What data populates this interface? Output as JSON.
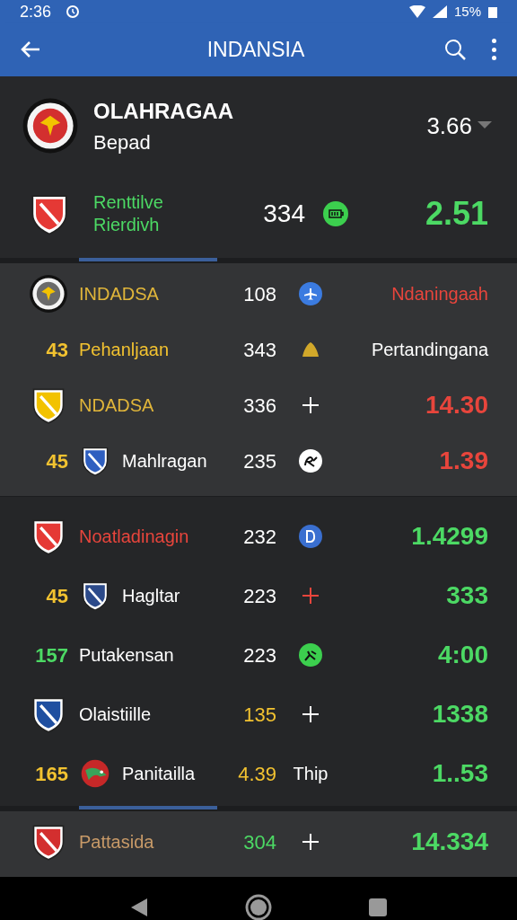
{
  "status_bar": {
    "time": "2:36",
    "battery": "15%"
  },
  "app_bar": {
    "title": "INDANSIA"
  },
  "header": {
    "title": "OLAHRAGAA",
    "subtitle": "Bepad",
    "value": "3.66",
    "crest": {
      "kind": "seal",
      "color": "#d32f2f"
    },
    "featured": {
      "crest": {
        "kind": "shield",
        "color": "#e53935"
      },
      "name_lines": [
        "Renttilve",
        "Rierdivh"
      ],
      "number": "334",
      "marker": {
        "kind": "battery",
        "color": "#3ccf4e"
      },
      "value": "2.51"
    }
  },
  "sections": [
    {
      "rows": [
        {
          "crest": {
            "kind": "seal",
            "color": "#6a6a6a"
          },
          "name": {
            "text": "INDADSA",
            "color": "#e0b53a"
          },
          "number": {
            "text": "108",
            "color": "#ffffff"
          },
          "marker": {
            "kind": "plane",
            "color": "#3b7be0"
          },
          "value": {
            "text": "Ndaningaah",
            "color": "#e8453c",
            "kind": "word"
          }
        },
        {
          "rank": {
            "text": "43",
            "color": "#f2c230"
          },
          "name": {
            "text": "Pehanljaan",
            "color": "#f2c230"
          },
          "number": {
            "text": "343",
            "color": "#ffffff"
          },
          "marker": {
            "kind": "cone",
            "color": "#d2a82a"
          },
          "value": {
            "text": "Pertandingana",
            "color": "#ffffff",
            "kind": "word"
          }
        },
        {
          "crest": {
            "kind": "shield",
            "color": "#f2c200"
          },
          "name": {
            "text": "NDADSA",
            "color": "#e0b53a"
          },
          "number": {
            "text": "336",
            "color": "#ffffff"
          },
          "marker": {
            "kind": "plus",
            "color": "#ffffff"
          },
          "value": {
            "text": "14.30",
            "color": "#e8453c",
            "kind": "number"
          }
        },
        {
          "rank": {
            "text": "45",
            "color": "#f2c230"
          },
          "crest": {
            "kind": "shield",
            "color": "#2f5fc0"
          },
          "name": {
            "text": "Mahlragan",
            "color": "#ffffff"
          },
          "number": {
            "text": "235",
            "color": "#ffffff"
          },
          "marker": {
            "kind": "scribble",
            "color": "#ffffff"
          },
          "value": {
            "text": "1.39",
            "color": "#e8453c",
            "kind": "number"
          }
        }
      ]
    },
    {
      "rows": [
        {
          "crest": {
            "kind": "shield",
            "color": "#e53935"
          },
          "name": {
            "text": "Noatladinagin",
            "color": "#e8453c"
          },
          "number": {
            "text": "232",
            "color": "#ffffff"
          },
          "marker": {
            "kind": "disc",
            "color": "#3a6fd0"
          },
          "value": {
            "text": "1.4299",
            "color": "#4cd964",
            "kind": "number"
          }
        },
        {
          "rank": {
            "text": "45",
            "color": "#f2c230"
          },
          "crest": {
            "kind": "shield",
            "color": "#2c4a8a"
          },
          "name": {
            "text": "Hagltar",
            "color": "#ffffff"
          },
          "number": {
            "text": "223",
            "color": "#ffffff"
          },
          "marker": {
            "kind": "plus",
            "color": "#e8453c"
          },
          "value": {
            "text": "333",
            "color": "#4cd964",
            "kind": "number"
          }
        },
        {
          "rank": {
            "text": "157",
            "color": "#4cd964"
          },
          "name": {
            "text": "Putakensan",
            "color": "#ffffff"
          },
          "number": {
            "text": "223",
            "color": "#ffffff"
          },
          "marker": {
            "kind": "runner",
            "color": "#3ccf4e"
          },
          "value": {
            "text": "4:00",
            "color": "#4cd964",
            "kind": "number"
          }
        },
        {
          "crest": {
            "kind": "shield",
            "color": "#1f4fa0"
          },
          "name": {
            "text": "Olaistiille",
            "color": "#ffffff"
          },
          "number": {
            "text": "135",
            "color": "#f2c230"
          },
          "marker": {
            "kind": "plus",
            "color": "#ffffff"
          },
          "value": {
            "text": "1338",
            "color": "#4cd964",
            "kind": "number"
          }
        },
        {
          "rank": {
            "text": "165",
            "color": "#f2c230"
          },
          "crest": {
            "kind": "dragon",
            "color": "#c62828"
          },
          "name": {
            "text": "Panitailla",
            "color": "#ffffff"
          },
          "number": {
            "text": "4.39",
            "color": "#f2c230"
          },
          "marker": {
            "kind": "text",
            "text": "Thip",
            "color": "#ffffff"
          },
          "value": {
            "text": "1..53",
            "color": "#4cd964",
            "kind": "number"
          }
        }
      ]
    },
    {
      "rows": [
        {
          "crest": {
            "kind": "shield",
            "color": "#d32f2f"
          },
          "name": {
            "text": "Pattasida",
            "color": "#c89a68"
          },
          "number": {
            "text": "304",
            "color": "#4cd964"
          },
          "marker": {
            "kind": "plus",
            "color": "#ffffff"
          },
          "value": {
            "text": "14.334",
            "color": "#4cd964",
            "kind": "number"
          }
        }
      ]
    }
  ]
}
